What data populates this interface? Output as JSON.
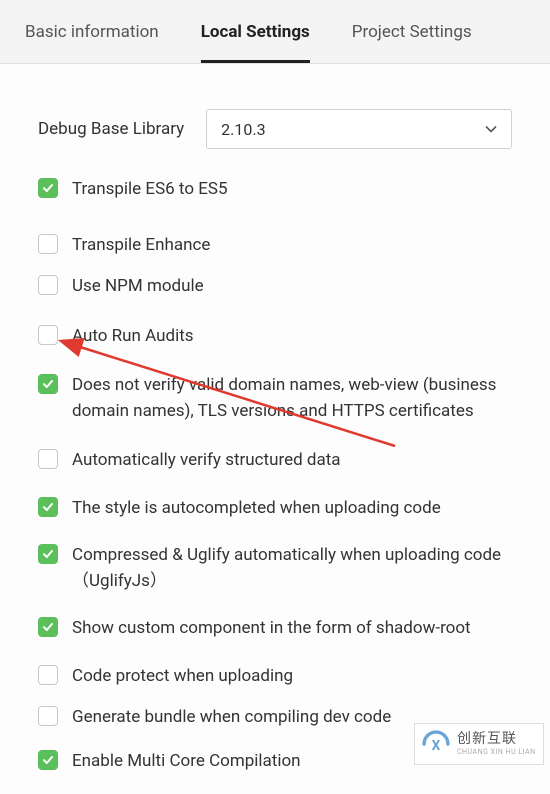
{
  "tabs": {
    "basic": "Basic information",
    "local": "Local Settings",
    "project": "Project Settings"
  },
  "library": {
    "label": "Debug Base Library",
    "selected": "2.10.3"
  },
  "options": [
    {
      "checked": true,
      "label": "Transpile ES6 to ES5"
    },
    {
      "checked": false,
      "label": "Transpile Enhance"
    },
    {
      "checked": false,
      "label": "Use NPM module"
    },
    {
      "checked": false,
      "label": "Auto Run Audits"
    },
    {
      "checked": true,
      "label": "Does not verify valid domain names, web-view (business domain names), TLS versions and HTTPS certificates"
    },
    {
      "checked": false,
      "label": "Automatically verify structured data"
    },
    {
      "checked": true,
      "label": "The style is autocompleted when uploading code"
    },
    {
      "checked": true,
      "label": "Compressed & Uglify automatically when uploading code （UglifyJs）"
    },
    {
      "checked": true,
      "label": "Show custom component in the form of shadow-root"
    },
    {
      "checked": false,
      "label": "Code protect when uploading"
    },
    {
      "checked": false,
      "label": "Generate bundle when compiling dev code"
    },
    {
      "checked": true,
      "label": "Enable Multi Core Compilation"
    }
  ],
  "watermark": {
    "cn": "创新互联",
    "en": "CHUANG XIN HU LIAN"
  },
  "colors": {
    "checkbox_green": "#5bbf5b",
    "arrow_red": "#e03a2f"
  }
}
